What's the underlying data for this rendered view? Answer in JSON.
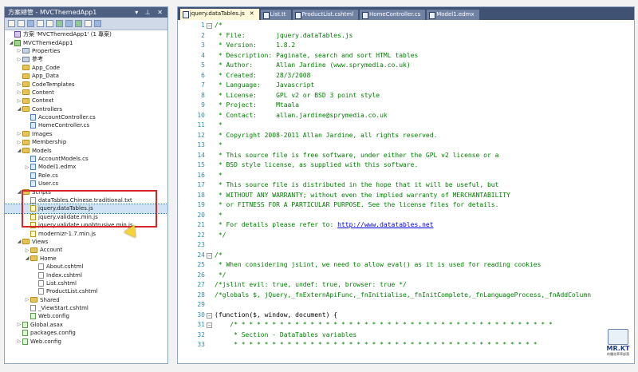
{
  "explorer": {
    "title": "方案總管 - MVCThemedApp1",
    "controls": "▾ ⊥ ✕",
    "items": [
      {
        "label": "方案 'MVCThemedApp1' (1 專案)",
        "icon": "sol",
        "indent": 0,
        "arrow": ""
      },
      {
        "label": "MVCThemedApp1",
        "icon": "proj",
        "indent": 0,
        "arrow": "◢"
      },
      {
        "label": "Properties",
        "icon": "ref",
        "indent": 1,
        "arrow": "▷"
      },
      {
        "label": "參考",
        "icon": "ref",
        "indent": 1,
        "arrow": "▷"
      },
      {
        "label": "App_Code",
        "icon": "folder",
        "indent": 1,
        "arrow": ""
      },
      {
        "label": "App_Data",
        "icon": "folder",
        "indent": 1,
        "arrow": ""
      },
      {
        "label": "CodeTemplates",
        "icon": "folder",
        "indent": 1,
        "arrow": "▷"
      },
      {
        "label": "Content",
        "icon": "folder",
        "indent": 1,
        "arrow": "▷"
      },
      {
        "label": "Context",
        "icon": "folder",
        "indent": 1,
        "arrow": "▷"
      },
      {
        "label": "Controllers",
        "icon": "folder",
        "indent": 1,
        "arrow": "◢"
      },
      {
        "label": "AccountController.cs",
        "icon": "cs",
        "indent": 2,
        "arrow": ""
      },
      {
        "label": "HomeController.cs",
        "icon": "cs",
        "indent": 2,
        "arrow": ""
      },
      {
        "label": "Images",
        "icon": "folder",
        "indent": 1,
        "arrow": "▷"
      },
      {
        "label": "Membership",
        "icon": "folder",
        "indent": 1,
        "arrow": "▷"
      },
      {
        "label": "Models",
        "icon": "folder",
        "indent": 1,
        "arrow": "◢"
      },
      {
        "label": "AccountModels.cs",
        "icon": "cs",
        "indent": 2,
        "arrow": ""
      },
      {
        "label": "Model1.edmx",
        "icon": "cs",
        "indent": 2,
        "arrow": "▷"
      },
      {
        "label": "Role.cs",
        "icon": "cs",
        "indent": 2,
        "arrow": ""
      },
      {
        "label": "User.cs",
        "icon": "cs",
        "indent": 2,
        "arrow": ""
      },
      {
        "label": "Scripts",
        "icon": "folder",
        "indent": 1,
        "arrow": "◢"
      },
      {
        "label": "dataTables.Chinese.traditional.txt",
        "icon": "file",
        "indent": 2,
        "arrow": ""
      },
      {
        "label": "jquery.dataTables.js",
        "icon": "js",
        "indent": 2,
        "arrow": "",
        "selected": true
      },
      {
        "label": "jquery.validate.min.js",
        "icon": "js",
        "indent": 2,
        "arrow": ""
      },
      {
        "label": "jquery.validate.unobtrusive.min.js",
        "icon": "js",
        "indent": 2,
        "arrow": ""
      },
      {
        "label": "modernizr-1.7.min.js",
        "icon": "js",
        "indent": 2,
        "arrow": ""
      },
      {
        "label": "Views",
        "icon": "folder",
        "indent": 1,
        "arrow": "◢"
      },
      {
        "label": "Account",
        "icon": "folder",
        "indent": 2,
        "arrow": "▷"
      },
      {
        "label": "Home",
        "icon": "folder",
        "indent": 2,
        "arrow": "◢"
      },
      {
        "label": "About.cshtml",
        "icon": "file",
        "indent": 3,
        "arrow": ""
      },
      {
        "label": "Index.cshtml",
        "icon": "file",
        "indent": 3,
        "arrow": ""
      },
      {
        "label": "List.cshtml",
        "icon": "file",
        "indent": 3,
        "arrow": ""
      },
      {
        "label": "ProductList.cshtml",
        "icon": "file",
        "indent": 3,
        "arrow": ""
      },
      {
        "label": "Shared",
        "icon": "folder",
        "indent": 2,
        "arrow": "▷"
      },
      {
        "label": "_ViewStart.cshtml",
        "icon": "file",
        "indent": 2,
        "arrow": ""
      },
      {
        "label": "Web.config",
        "icon": "web",
        "indent": 2,
        "arrow": ""
      },
      {
        "label": "Global.asax",
        "icon": "web",
        "indent": 1,
        "arrow": "▷"
      },
      {
        "label": "packages.config",
        "icon": "web",
        "indent": 1,
        "arrow": ""
      },
      {
        "label": "Web.config",
        "icon": "web",
        "indent": 1,
        "arrow": "▷"
      }
    ]
  },
  "tabs": [
    {
      "label": "jquery.dataTables.js",
      "active": true
    },
    {
      "label": "List.tt",
      "active": false
    },
    {
      "label": "ProductList.cshtml",
      "active": false
    },
    {
      "label": "HomeController.cs",
      "active": false
    },
    {
      "label": "Model1.edmx",
      "active": false
    }
  ],
  "code": [
    {
      "n": "1",
      "t": "/*",
      "fold": "−",
      "c": "g"
    },
    {
      "n": "2",
      "t": " * File:        jquery.dataTables.js",
      "c": "g"
    },
    {
      "n": "3",
      "t": " * Version:     1.8.2",
      "c": "g"
    },
    {
      "n": "4",
      "t": " * Description: Paginate, search and sort HTML tables",
      "c": "g"
    },
    {
      "n": "5",
      "t": " * Author:      Allan Jardine (www.sprymedia.co.uk)",
      "c": "g"
    },
    {
      "n": "6",
      "t": " * Created:     28/3/2008",
      "c": "g"
    },
    {
      "n": "7",
      "t": " * Language:    Javascript",
      "c": "g"
    },
    {
      "n": "8",
      "t": " * License:     GPL v2 or BSD 3 point style",
      "c": "g"
    },
    {
      "n": "9",
      "t": " * Project:     Mtaala",
      "c": "g"
    },
    {
      "n": "10",
      "t": " * Contact:     allan.jardine@sprymedia.co.uk",
      "c": "g"
    },
    {
      "n": "11",
      "t": " *",
      "c": "g"
    },
    {
      "n": "12",
      "t": " * Copyright 2008-2011 Allan Jardine, all rights reserved.",
      "c": "g"
    },
    {
      "n": "13",
      "t": " *",
      "c": "g"
    },
    {
      "n": "14",
      "t": " * This source file is free software, under either the GPL v2 license or a",
      "c": "g"
    },
    {
      "n": "15",
      "t": " * BSD style license, as supplied with this software.",
      "c": "g"
    },
    {
      "n": "16",
      "t": " *",
      "c": "g"
    },
    {
      "n": "17",
      "t": " * This source file is distributed in the hope that it will be useful, but",
      "c": "g"
    },
    {
      "n": "18",
      "t": " * WITHOUT ANY WARRANTY; without even the implied warranty of MERCHANTABILITY",
      "c": "g"
    },
    {
      "n": "19",
      "t": " * or FITNESS FOR A PARTICULAR PURPOSE. See the license files for details.",
      "c": "g"
    },
    {
      "n": "20",
      "t": " *",
      "c": "g"
    },
    {
      "n": "21",
      "t": " * For details please refer to: ",
      "link": "http://www.datatables.net",
      "c": "g"
    },
    {
      "n": "22",
      "t": " */",
      "c": "g"
    },
    {
      "n": "23",
      "t": "",
      "c": "g"
    },
    {
      "n": "24",
      "t": "/*",
      "fold": "−",
      "c": "g"
    },
    {
      "n": "25",
      "t": " * When considering jsLint, we need to allow eval() as it is used for reading cookies",
      "c": "g"
    },
    {
      "n": "26",
      "t": " */",
      "c": "g"
    },
    {
      "n": "27",
      "t": "/*jslint evil: true, undef: true, browser: true */",
      "c": "g"
    },
    {
      "n": "28",
      "t": "/*globals $, jQuery,_fnExternApiFunc,_fnInitialise,_fnInitComplete,_fnLanguageProcess,_fnAddColumn",
      "c": "g"
    },
    {
      "n": "29",
      "t": "",
      "c": "g"
    },
    {
      "n": "30",
      "t": "(function($, window, document) {",
      "fold": "−",
      "c": "k"
    },
    {
      "n": "31",
      "t": "    /* * * * * * * * * * * * * * * * * * * * * * * * * * * * * * * * * * * * * * * * * *",
      "fold": "−",
      "c": "g"
    },
    {
      "n": "32",
      "t": "     * Section - DataTables variables",
      "c": "g"
    },
    {
      "n": "33",
      "t": "     * * * * * * * * * * * * * * * * * * * * * * * * * * * * * * * * * * * * * * * *",
      "c": "g"
    }
  ],
  "logo": {
    "title": "MR.KT",
    "subtitle": "的種花草草部落"
  }
}
